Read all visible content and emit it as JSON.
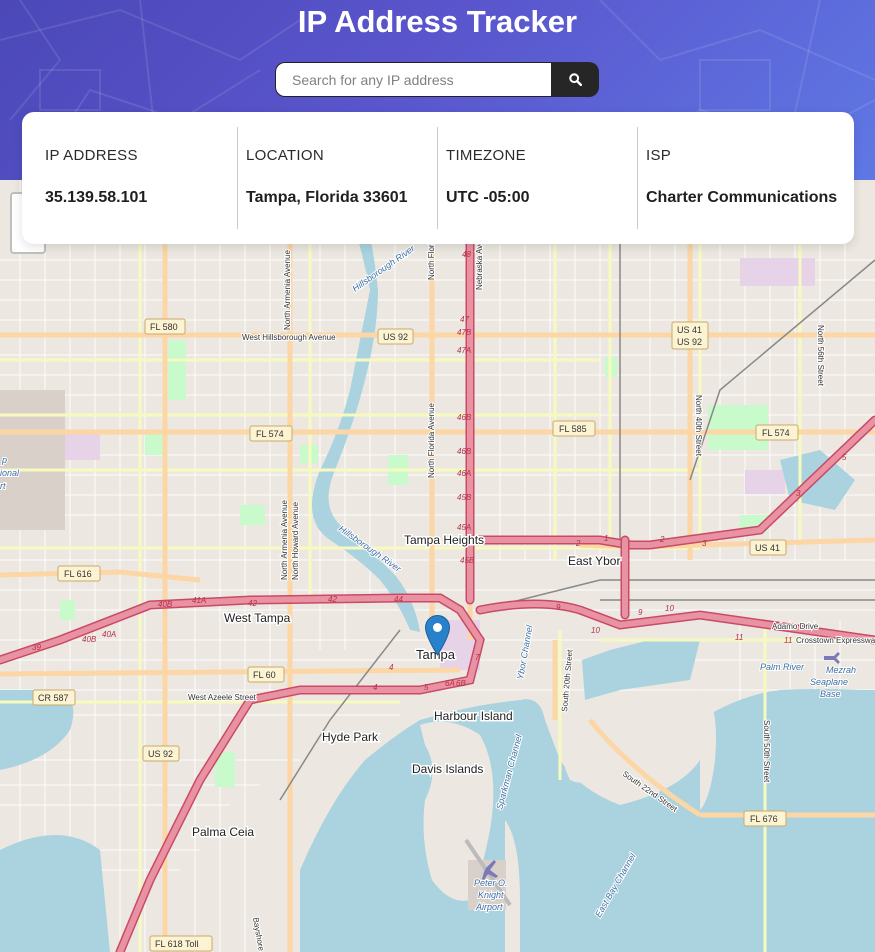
{
  "header": {
    "title": "IP Address Tracker",
    "search_placeholder": "Search for any IP address",
    "search_button_icon": "search-icon"
  },
  "info": [
    {
      "label": "IP ADDRESS",
      "value": "35.139.58.101"
    },
    {
      "label": "LOCATION",
      "value": "Tampa, Florida 33601"
    },
    {
      "label": "TIMEZONE",
      "value": "UTC -05:00"
    },
    {
      "label": "ISP",
      "value": "Charter Communications"
    }
  ],
  "map": {
    "marker_icon": "map-marker-icon",
    "places": {
      "tampa": "Tampa",
      "tampa_heights": "Tampa Heights",
      "east_ybor": "East Ybor",
      "west_tampa": "West Tampa",
      "harbour_island": "Harbour Island",
      "hyde_park": "Hyde Park",
      "davis_islands": "Davis Islands",
      "palma_ceia": "Palma Ceia",
      "palm_river": "Palm River",
      "seaplane_base": [
        "Mezrah",
        "Seaplane",
        "Base"
      ],
      "airport": [
        "Peter O.",
        "Knight",
        "Airport"
      ],
      "airport_edge": [
        "p",
        "ional",
        "rt"
      ]
    },
    "shields": {
      "fl580": "FL 580",
      "us92_top": "US 92",
      "us41_top": "US 41",
      "us92_top2": "US 92",
      "fl574_left": "FL 574",
      "fl585": "FL 585",
      "fl574_right": "FL 574",
      "fl616": "FL 616",
      "us41_mid": "US 41",
      "fl60": "FL 60",
      "cr587": "CR 587",
      "us92_bottom": "US 92",
      "fl676": "FL 676",
      "fl618": "FL 618 Toll"
    },
    "streets": {
      "west_hillsborough": "West Hillsborough Avenue",
      "north_armenia_top": "North Armenia Avenue",
      "north_florida_top": "North Florida Avenue",
      "nebraska": "Nebraska Avenue",
      "hillsborough_river_top": "Hillsborough River",
      "north_56th": "North 56th Street",
      "north_40th": "North 40th Street",
      "north_florida_mid": "North Florida Avenue",
      "hillsborough_river_mid": "Hillsborough River",
      "north_armenia_mid": "North Armenia Avenue",
      "north_howard": "North Howard Avenue",
      "west_azeele": "West Azeele Street",
      "ybor_channel": "Ybor Channel",
      "south_20th": "South 20th Street",
      "sparkman_channel": "Sparkman Channel",
      "south_22nd": "South 22nd Street",
      "south_50th": "South 50th Street",
      "adamo": "Adamo Drive",
      "crosstown": "Crosstown Expressway",
      "east_bay": "East Bay Channel",
      "bayshore": "Bayshore Bo"
    },
    "exits": [
      "48",
      "47",
      "47B",
      "47A",
      "46B",
      "46B",
      "46A",
      "45B",
      "45A",
      "45B",
      "2",
      "1",
      "2",
      "3",
      "3",
      "5",
      "44",
      "42",
      "42",
      "41A",
      "40B",
      "40B",
      "40A",
      "39",
      "4",
      "4",
      "5",
      "6A",
      "6B",
      "7",
      "9",
      "9",
      "10",
      "10",
      "11",
      "11"
    ]
  },
  "colors": {
    "header_gradient_start": "#4b48b8",
    "header_gradient_end": "#5f78e4",
    "search_button": "#262626",
    "map_land": "#ece8e1",
    "map_water": "#aad3df",
    "motorway": "#e892a2",
    "primary_road": "#fcd6a4",
    "secondary_road": "#f7fabf",
    "park": "#c8facc",
    "marker": "#2a81cb"
  }
}
